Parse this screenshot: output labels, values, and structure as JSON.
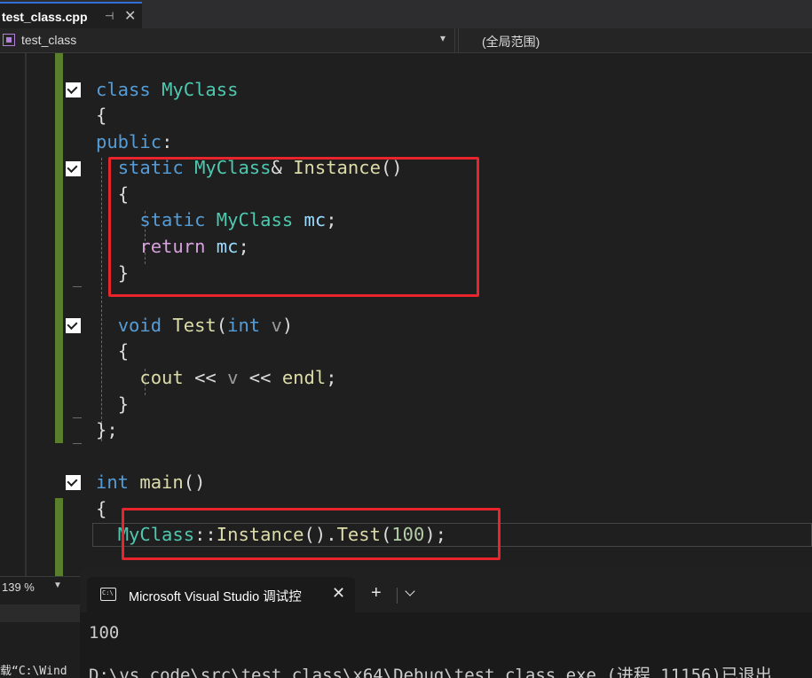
{
  "tab": {
    "title": "test_class.cpp",
    "pin": "⊣",
    "close": "✕"
  },
  "navbar": {
    "scope_left": "test_class",
    "scope_right": "(全局范围)"
  },
  "code": {
    "l1": {
      "kw": "class",
      "name": "MyClass"
    },
    "l2": "{",
    "l3": {
      "kw": "public",
      "colon": ":"
    },
    "l4": {
      "kw": "static",
      "type": "MyClass",
      "amp": "&",
      "fn": "Instance",
      "paren": "()"
    },
    "l5": "{",
    "l6": {
      "kw": "static",
      "type": "MyClass",
      "var": "mc",
      "semi": ";"
    },
    "l7": {
      "kw": "return",
      "var": "mc",
      "semi": ";"
    },
    "l8": "}",
    "l9": {
      "kw": "void",
      "fn": "Test",
      "open": "(",
      "ptype": "int",
      "param": "v",
      "close": ")"
    },
    "l10": "{",
    "l11": {
      "fn": "cout",
      "op1": " << ",
      "param": "v",
      "op2": " << ",
      "fn2": "endl",
      "semi": ";"
    },
    "l12": "}",
    "l13": "};",
    "l14": {
      "kw": "int",
      "fn": "main",
      "paren": "()"
    },
    "l15": "{",
    "l16": {
      "type": "MyClass",
      "scope": "::",
      "fn": "Instance",
      "mid": "().",
      "fn2": "Test",
      "open": "(",
      "num": "100",
      "close": ");"
    }
  },
  "zoom": {
    "level": "139 %"
  },
  "output_snippet": "载“C:\\Wind",
  "terminal": {
    "title": "Microsoft Visual Studio 调试控",
    "close": "✕",
    "new_tab": "+",
    "line1": "100",
    "line2": "D:\\vs code\\src\\test class\\x64\\Debug\\test class.exe (进程 11156)已退出"
  },
  "colors": {
    "keyword": "#569cd6",
    "type": "#4ec9b0",
    "function": "#dcdcaa",
    "highlight_box": "#e8252c"
  }
}
